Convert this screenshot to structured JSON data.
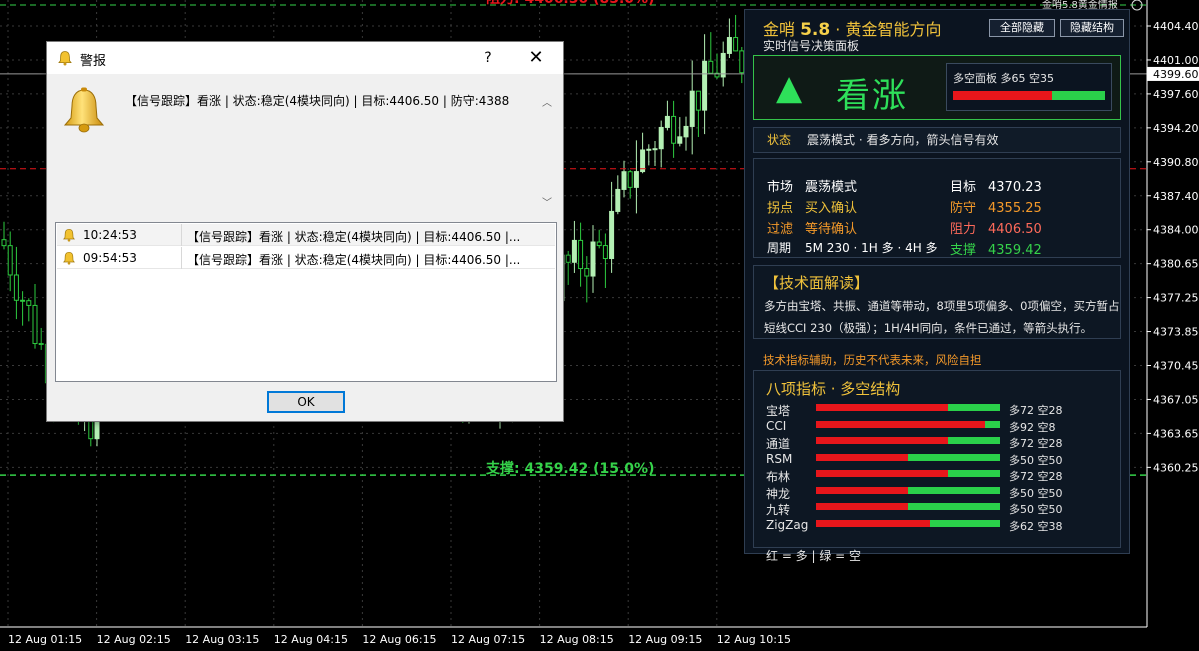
{
  "chart": {
    "price_ticks": [
      "4404.40",
      "4401.00",
      "4397.60",
      "4394.20",
      "4390.80",
      "4387.40",
      "4384.00",
      "4380.65",
      "4377.25",
      "4373.85",
      "4370.45",
      "4367.05",
      "4363.65",
      "4360.25"
    ],
    "current_price": "4399.60",
    "time_ticks": [
      "12 Aug 01:15",
      "12 Aug 02:15",
      "12 Aug 03:15",
      "12 Aug 04:15",
      "12 Aug 06:15",
      "12 Aug 07:15",
      "12 Aug 08:15",
      "12 Aug 09:15",
      "12 Aug 10:15"
    ],
    "support_label": "支撑: 4359.42 (15.0%)",
    "resistance_label_partial": "阻力: 4406.50 (85.0%)",
    "corner_text": "金哨5.8黄金情报",
    "colors": {
      "bull": "#b4f0b4",
      "bear": "#2ecc40",
      "grid": "#3a3a3a",
      "support": "#35d24a",
      "resistance": "#e8161b"
    }
  },
  "panel": {
    "title_prefix": "金哨 ",
    "version": "5.8",
    "title_suffix": " · 黄金智能方向",
    "subtitle": "实时信号决策面板",
    "btn_hide_all": "全部隐藏",
    "btn_hide_structure": "隐藏结构",
    "signal_arrow": "▲",
    "signal_text": "看涨",
    "ratio_label": "多空面板  多65 空35",
    "ratio_long": 65,
    "status_key": "状态",
    "status_value": "震荡模式 · 看多方向，箭头信号有效",
    "info": {
      "market_k": "市场",
      "market_v": "震荡模式",
      "trigger_k": "拐点",
      "trigger_v": "买入确认",
      "filter_k": "过滤",
      "filter_v": "等待确认",
      "period_k": "周期",
      "period_v": "5M 230 · 1H 多 · 4H 多",
      "target_k": "目标",
      "target_v": "4370.23",
      "stop_k": "防守",
      "stop_v": "4355.25",
      "resist_k": "阻力",
      "resist_v": "4406.50",
      "support_k": "支撑",
      "support_v": "4359.42"
    },
    "tech_title": "【技术面解读】",
    "tech_line1": "多方由宝塔、共振、通道等带动，8项里5项偏多、0项偏空，买方暂占主",
    "tech_line2": "短线CCI 230（极强）；1H/4H同向，条件已通过，等箭头执行。",
    "disclaimer": "技术指标辅助，历史不代表未来，风险自担",
    "indicators_title": "八项指标 · 多空结构",
    "indicators": [
      {
        "name": "宝塔",
        "long": 72,
        "label": "多72 空28"
      },
      {
        "name": "CCI",
        "long": 92,
        "label": "多92 空8"
      },
      {
        "name": "通道",
        "long": 72,
        "label": "多72 空28"
      },
      {
        "name": "RSM",
        "long": 50,
        "label": "多50 空50"
      },
      {
        "name": "布林",
        "long": 72,
        "label": "多72 空28"
      },
      {
        "name": "神龙",
        "long": 50,
        "label": "多50 空50"
      },
      {
        "name": "九转",
        "long": 50,
        "label": "多50 空50"
      },
      {
        "name": "ZigZag",
        "long": 62,
        "label": "多62 空38"
      }
    ],
    "legend": "红 = 多   |   绿 = 空"
  },
  "dialog": {
    "title": "警报",
    "help": "?",
    "close": "✕",
    "message": "【信号跟踪】看涨 | 状态:稳定(4模块同向) | 目标:4406.50 | 防守:4388",
    "rows": [
      {
        "time": "10:24:53",
        "message": "【信号跟踪】看涨 | 状态:稳定(4模块同向) | 目标:4406.50 |..."
      },
      {
        "time": "09:54:53",
        "message": "【信号跟踪】看涨 | 状态:稳定(4模块同向) | 目标:4406.50 |..."
      }
    ],
    "ok_label": "OK"
  }
}
